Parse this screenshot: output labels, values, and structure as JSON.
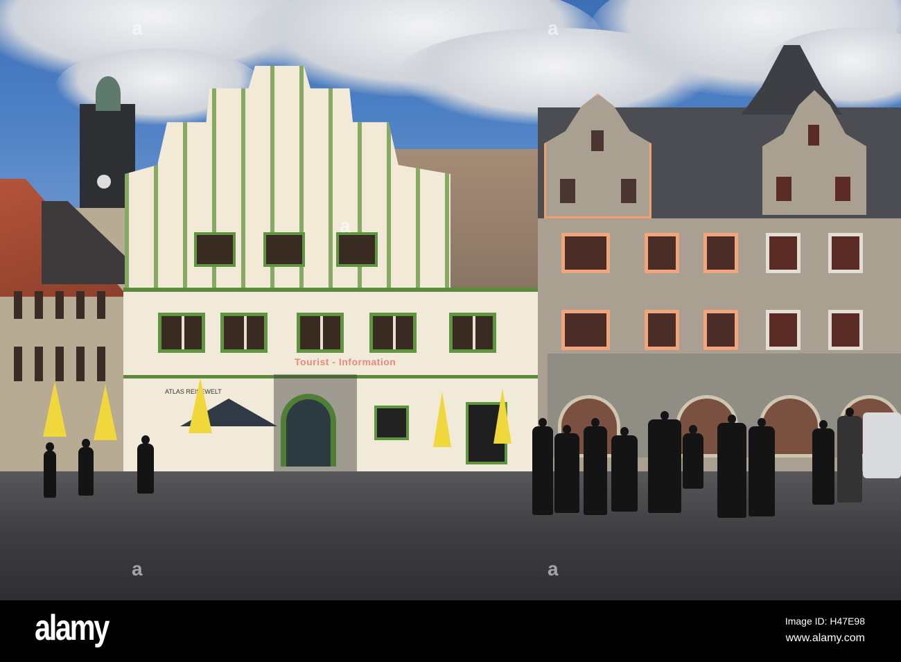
{
  "scene": {
    "signs": {
      "tourist_information": "Tourist - Information",
      "atlas_sign": "ATLAS REISEWELT"
    }
  },
  "footer": {
    "logo": "alamy",
    "image_id": "Image ID: H47E98",
    "website": "www.alamy.com"
  },
  "watermark": "a",
  "colors": {
    "sky": "#4d80c4",
    "green_trim": "#5f9440",
    "orange_trim": "#f2a57a",
    "footer": "#000000"
  }
}
